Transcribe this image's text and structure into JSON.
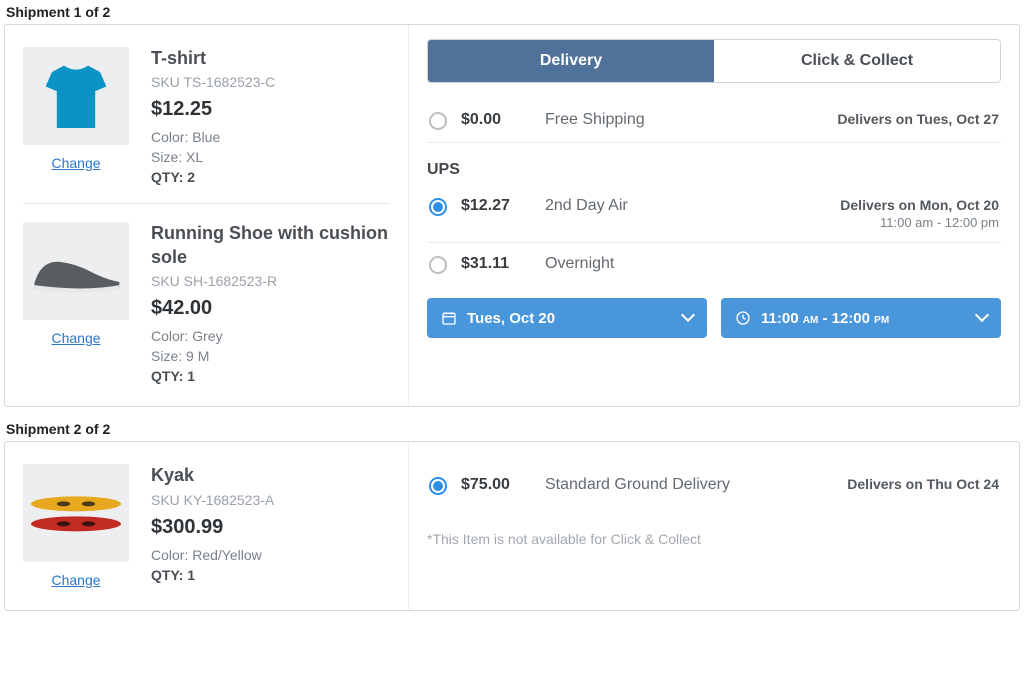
{
  "shipments": [
    {
      "label": "Shipment 1 of 2",
      "items": [
        {
          "title": "T-shirt",
          "sku": "SKU TS-1682523-C",
          "price": "$12.25",
          "color": "Color: Blue",
          "size": "Size: XL",
          "qty": "QTY: 2",
          "change": "Change"
        },
        {
          "title": "Running Shoe with cushion sole",
          "sku": "SKU SH-1682523-R",
          "price": "$42.00",
          "color": "Color: Grey",
          "size": "Size: 9 M",
          "qty": "QTY: 1",
          "change": "Change"
        }
      ],
      "tabs": {
        "delivery": "Delivery",
        "collect": "Click & Collect"
      },
      "options": [
        {
          "price": "$0.00",
          "name": "Free Shipping",
          "delivers": "Delivers on Tues, Oct 27",
          "sub": "",
          "selected": false
        },
        {
          "header": "UPS"
        },
        {
          "price": "$12.27",
          "name": "2nd Day Air",
          "delivers": "Delivers on Mon, Oct 20",
          "sub": "11:00 am - 12:00 pm",
          "selected": true
        },
        {
          "price": "$31.11",
          "name": "Overnight",
          "delivers": "",
          "sub": "",
          "selected": false
        }
      ],
      "pickers": {
        "date": "Tues, Oct 20",
        "time_h1": "11:00",
        "time_ampm1": "AM",
        "time_sep": " - ",
        "time_h2": "12:00",
        "time_ampm2": "PM"
      }
    },
    {
      "label": "Shipment 2 of 2",
      "items": [
        {
          "title": "Kyak",
          "sku": "SKU KY-1682523-A",
          "price": "$300.99",
          "color": "Color: Red/Yellow",
          "qty": "QTY: 1",
          "change": "Change"
        }
      ],
      "options": [
        {
          "price": "$75.00",
          "name": "Standard Ground Delivery",
          "delivers": "Delivers on Thu Oct 24",
          "selected": true
        }
      ],
      "note": "*This Item is not available for Click & Collect"
    }
  ]
}
